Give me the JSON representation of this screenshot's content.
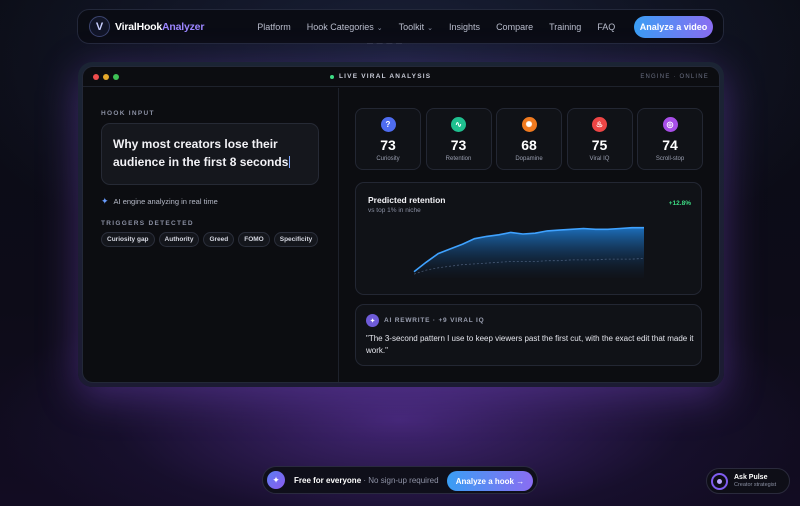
{
  "nav": {
    "brand_primary": "ViralHook",
    "brand_accent": "Analyzer",
    "logo_letter": "V",
    "links": [
      "Platform",
      "Hook Categories",
      "Toolkit",
      "Insights",
      "Compare",
      "Training",
      "FAQ"
    ],
    "dropdown_flags": [
      false,
      true,
      true,
      false,
      false,
      false,
      false
    ],
    "cta": "Analyze a video"
  },
  "window": {
    "status": "LIVE VIRAL ANALYSIS",
    "engine": "ENGINE · ONLINE"
  },
  "hook": {
    "label": "HOOK INPUT",
    "text": "Why most creators lose their audience in the first 8 seconds",
    "engine_note": "AI engine analyzing in real time",
    "triggers_label": "TRIGGERS DETECTED",
    "triggers": [
      "Curiosity gap",
      "Authority",
      "Greed",
      "FOMO",
      "Specificity"
    ]
  },
  "metrics": [
    {
      "value": "73",
      "label": "Curiosity",
      "icon": "question-icon",
      "color": "#4e6cf0"
    },
    {
      "value": "73",
      "label": "Retention",
      "icon": "pulse-icon",
      "color": "#1fbf8f"
    },
    {
      "value": "68",
      "label": "Dopamine",
      "icon": "bolt-icon",
      "color": "#f07a1f"
    },
    {
      "value": "75",
      "label": "Viral IQ",
      "icon": "flame-icon",
      "color": "#ee4545"
    },
    {
      "value": "74",
      "label": "Scroll-stop",
      "icon": "target-icon",
      "color": "#a84ee8"
    }
  ],
  "retention": {
    "title": "Predicted retention",
    "subtitle": "vs top 1% in niche",
    "delta": "+12.8%",
    "series": [
      {
        "values": [
          8,
          20,
          31,
          37,
          43,
          50,
          53,
          55,
          58,
          56,
          57,
          60,
          61,
          62,
          63,
          62,
          62,
          63,
          64,
          64
        ]
      },
      {
        "values": [
          5,
          10,
          13,
          15,
          17,
          18,
          19,
          20,
          21,
          21,
          21,
          22,
          22,
          23,
          23,
          23,
          24,
          24,
          24,
          25
        ]
      }
    ]
  },
  "rewrite": {
    "label": "AI REWRITE · +9 VIRAL IQ",
    "text": "\"The 3-second pattern I use to keep viewers past the first cut, with the exact edit that made it work.\""
  },
  "bottom": {
    "text_bold": "Free for everyone",
    "text_rest": "· No sign-up required",
    "cta": "Analyze a hook"
  },
  "pulse": {
    "title": "Ask Pulse",
    "subtitle": "Creator strategist"
  }
}
